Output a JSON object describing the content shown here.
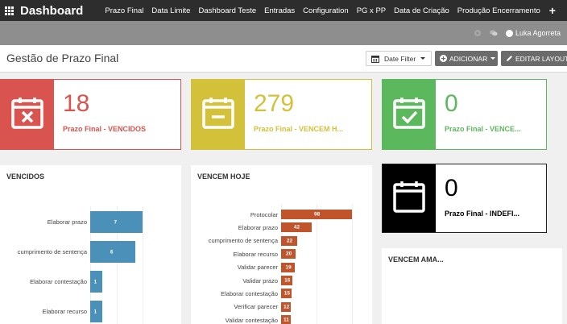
{
  "nav": {
    "brand": "Dashboard",
    "items": [
      "Prazo Final",
      "Data Limite",
      "Dashboard Teste",
      "Entradas",
      "Configuration",
      "PG x PP",
      "Data de Criação",
      "Produção Encerramento"
    ],
    "add_label": "+"
  },
  "userbar": {
    "user_name": "Luka Agorreta"
  },
  "header": {
    "title": "Gestão de Prazo Final",
    "date_filter_label": "Date Filter",
    "add_label": "ADICIONAR",
    "edit_label": "EDITAR LAYOUT"
  },
  "cards": [
    {
      "count": "18",
      "label": "Prazo Final - VENCIDOS",
      "color": "#d9534f",
      "icon": "calendar-x-icon"
    },
    {
      "count": "279",
      "label": "Prazo Final - VENCEM H...",
      "color": "#d4c13a",
      "icon": "calendar-minus-icon"
    },
    {
      "count": "0",
      "label": "Prazo Final - VENCE...",
      "color": "#5cb85c",
      "icon": "calendar-check-icon"
    },
    {
      "count": "0",
      "label": "Prazo Final - INDEFI...",
      "color": "#000000",
      "icon": "calendar-blank-icon"
    }
  ],
  "panels": {
    "vencidos": {
      "title": "VENCIDOS",
      "color": "#4a90b8",
      "bars": [
        {
          "label": "Elaborar prazo",
          "value": 7
        },
        {
          "label": "cumprimento de sentença",
          "value": 6
        },
        {
          "label": "Elaborar contestação",
          "value": 1
        },
        {
          "label": "Elaborar recurso",
          "value": 1
        }
      ]
    },
    "vencem_hoje": {
      "title": "VENCEM HOJE",
      "color": "#c0542b",
      "bars": [
        {
          "label": "Protocolar",
          "value": 98
        },
        {
          "label": "Elaborar prazo",
          "value": 42
        },
        {
          "label": "cumprimento de sentença",
          "value": 22
        },
        {
          "label": "Elaborar recurso",
          "value": 20
        },
        {
          "label": "Validar parecer",
          "value": 19
        },
        {
          "label": "Validar prazo",
          "value": 16
        },
        {
          "label": "Elaborar contestação",
          "value": 15
        },
        {
          "label": "Verificar parecer",
          "value": 12
        },
        {
          "label": "Validar contestação",
          "value": 11
        }
      ]
    },
    "vencem_amanha": {
      "title": "VENCEM AMA..."
    }
  }
}
